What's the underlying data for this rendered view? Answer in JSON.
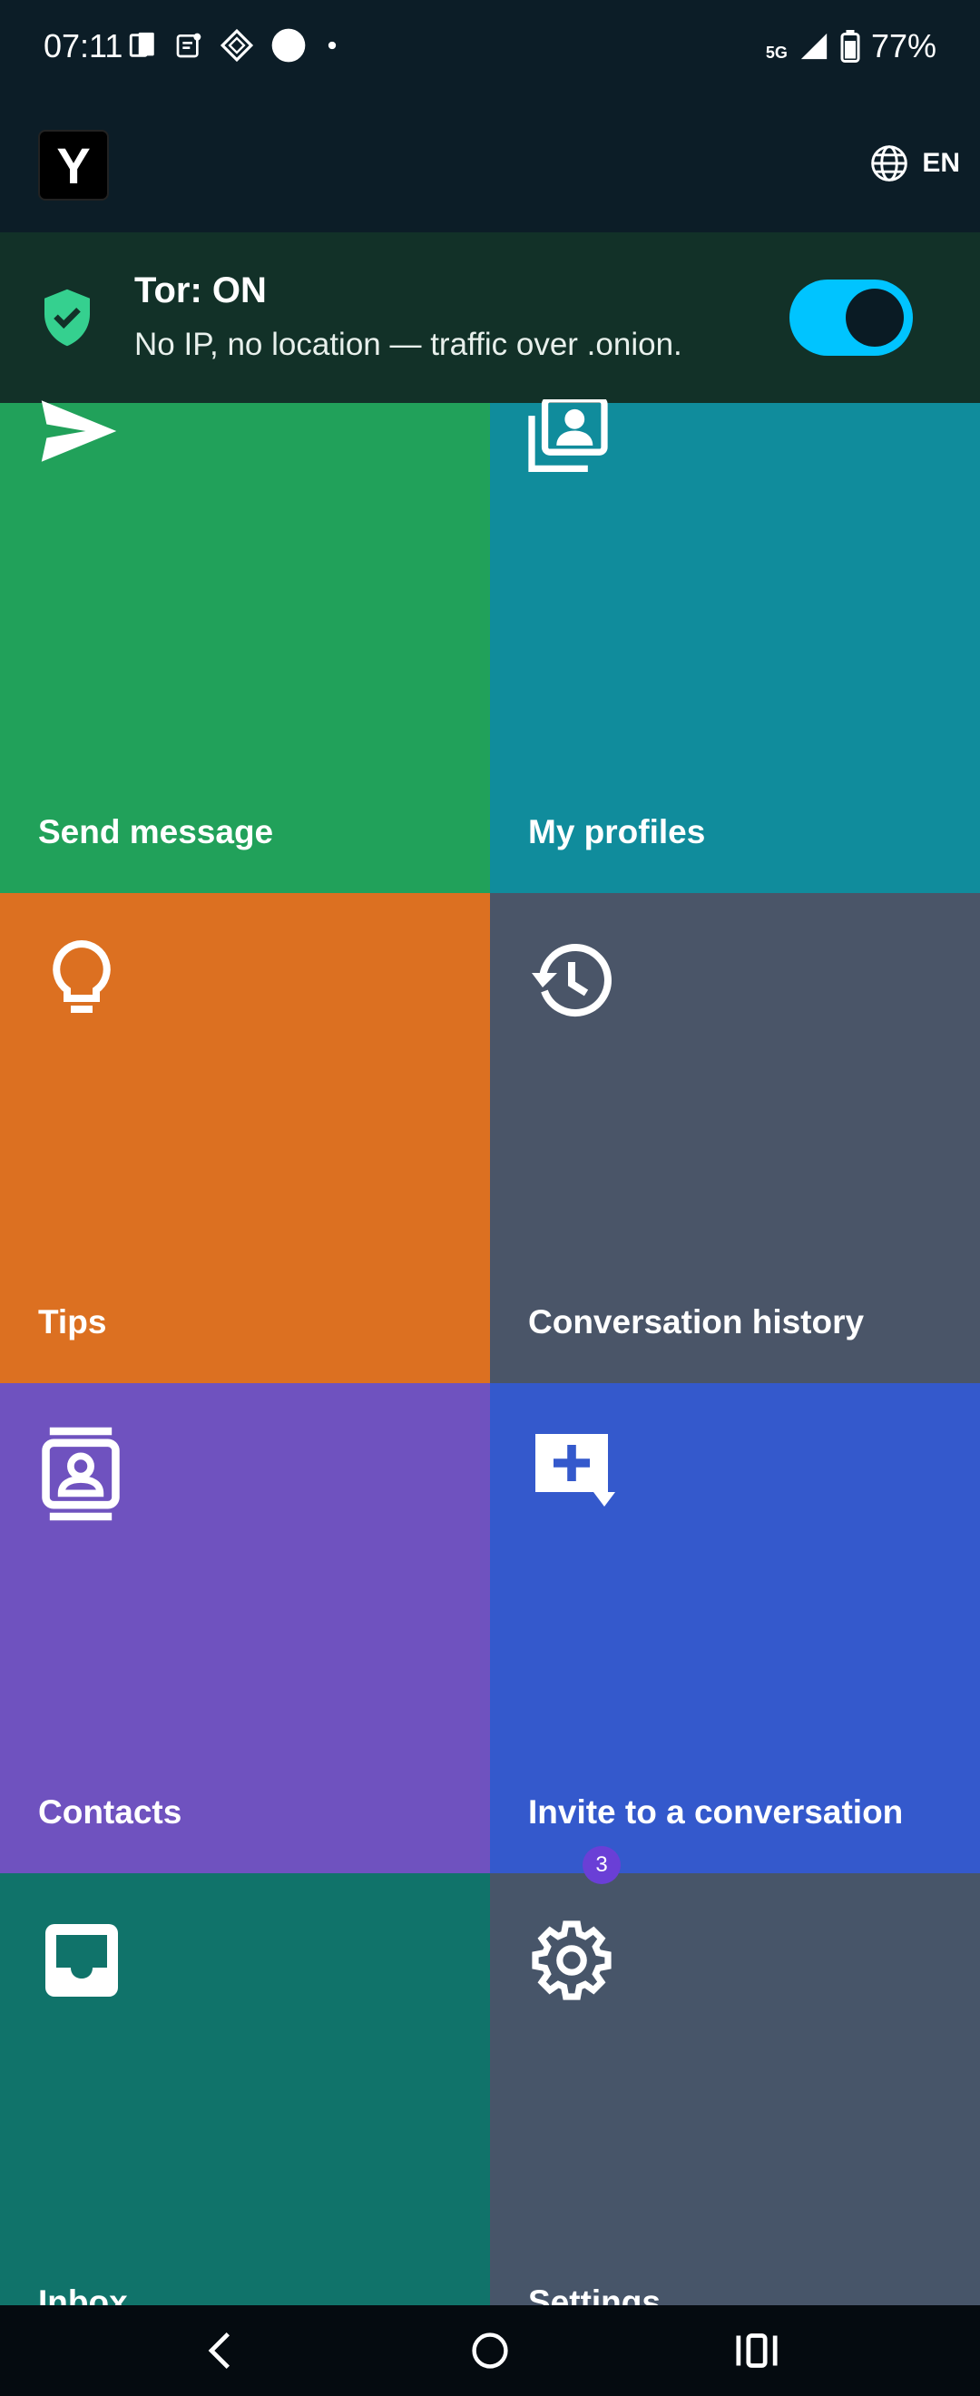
{
  "status_bar": {
    "time": "07:11",
    "network": "5G",
    "battery": "77%"
  },
  "app_bar": {
    "logo_letter": "Y",
    "language": "EN"
  },
  "tor": {
    "title": "Tor: ON",
    "subtitle": "No IP, no location — traffic over .onion.",
    "enabled": true
  },
  "tiles": [
    {
      "label": "Send message",
      "icon": "send-icon",
      "color": "#21a15a"
    },
    {
      "label": "My profiles",
      "icon": "profiles-icon",
      "color": "#108c9c"
    },
    {
      "label": "Tips",
      "icon": "lightbulb-icon",
      "color": "#dc7021"
    },
    {
      "label": "Conversation history",
      "icon": "history-icon",
      "color": "#4a5568"
    },
    {
      "label": "Contacts",
      "icon": "contacts-icon",
      "color": "#6f52bf"
    },
    {
      "label": "Invite to a conversation",
      "icon": "add-comment-icon",
      "color": "#3459cc"
    },
    {
      "label": "Inbox",
      "icon": "inbox-icon",
      "color": "#10736a"
    },
    {
      "label": "Settings",
      "icon": "gear-icon",
      "color": "#475569"
    }
  ],
  "settings_badge": "3"
}
